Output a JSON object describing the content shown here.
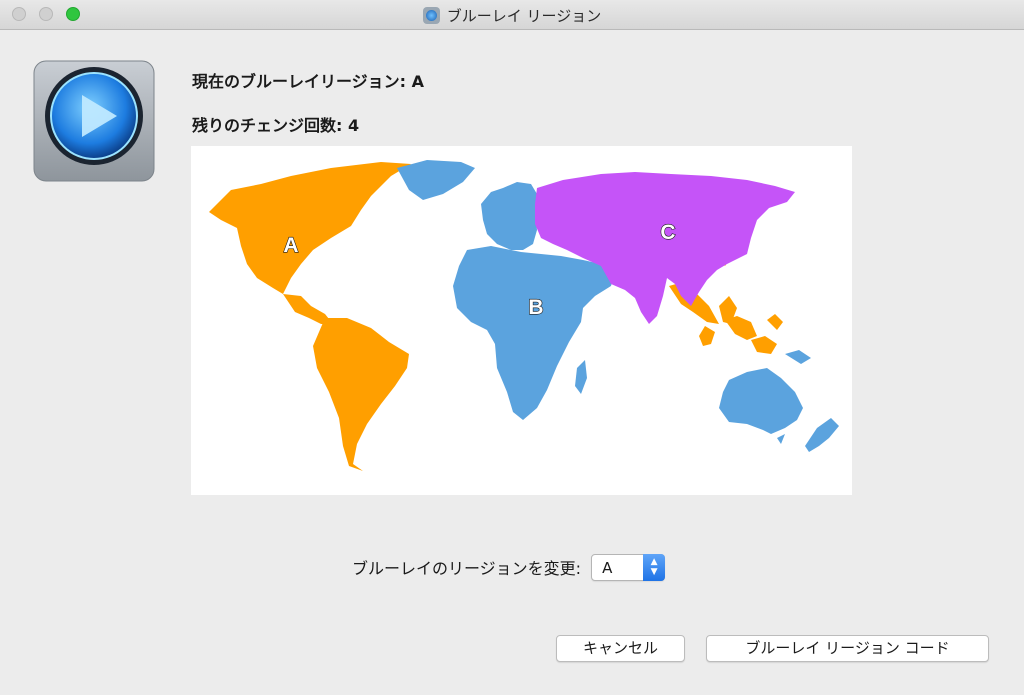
{
  "window": {
    "title": "ブルーレイ リージョン",
    "colors": {
      "close": "#d0d0d0",
      "minimize": "#d0d0d0",
      "zoom": "#2fc63f"
    }
  },
  "info": {
    "current_region_label": "現在のブルーレイリージョン: A",
    "remaining_changes_label": "残りのチェンジ回数: 4"
  },
  "map": {
    "regions": [
      {
        "letter": "A",
        "color": "#ff9f00"
      },
      {
        "letter": "B",
        "color": "#5ba3de"
      },
      {
        "letter": "C",
        "color": "#c554f8"
      }
    ]
  },
  "change_region": {
    "label": "ブルーレイのリージョンを変更:",
    "selected": "A",
    "stepper_icon": "up-down-chevron-icon"
  },
  "buttons": {
    "cancel": "キャンセル",
    "region_code": "ブルーレイ リージョン コード"
  }
}
